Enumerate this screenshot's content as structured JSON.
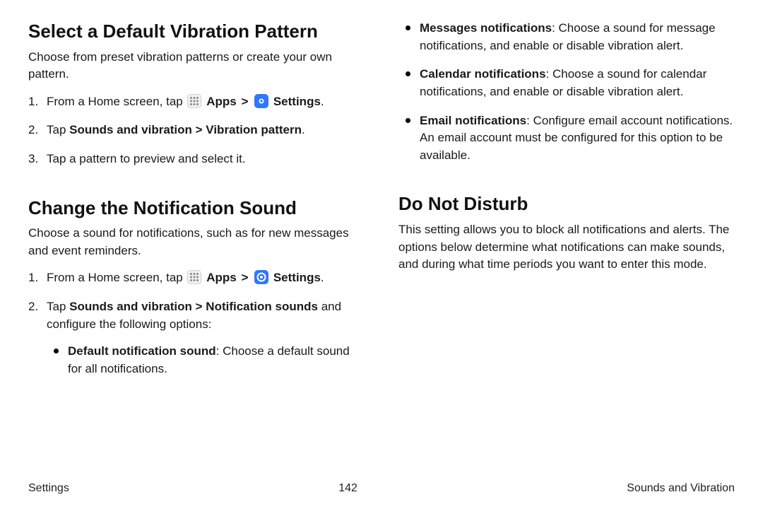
{
  "leftColumn": {
    "section1": {
      "heading": "Select a Default Vibration Pattern",
      "intro": "Choose from preset vibration patterns or create your own pattern.",
      "step1_pre": "From a Home screen, tap ",
      "apps_label": "Apps",
      "settings_label": "Settings",
      "step2_pre": "Tap ",
      "step2_bold": "Sounds and vibration > Vibration pattern",
      "step2_post": ".",
      "step3": "Tap a pattern to preview and select it."
    },
    "section2": {
      "heading": "Change the Notification Sound",
      "intro": "Choose a sound for notifications, such as for new messages and event reminders.",
      "step1_pre": "From a Home screen, tap ",
      "apps_label": "Apps",
      "settings_label": "Settings",
      "step2_pre": "Tap ",
      "step2_bold": "Sounds and vibration > Notification sounds",
      "step2_post": " and configure the following options:",
      "bullet1_bold": "Default notification sound",
      "bullet1_rest": ": Choose a default sound for all notifications."
    }
  },
  "rightColumn": {
    "bullets": {
      "b1_bold": "Messages notifications",
      "b1_rest": ": Choose a sound for message notifications, and enable or disable vibration alert.",
      "b2_bold": "Calendar notifications",
      "b2_rest": ": Choose a sound for calendar notifications, and enable or disable vibration alert.",
      "b3_bold": "Email notifications",
      "b3_rest": ": Configure email account notifications. An email account must be configured for this option to be available."
    },
    "section": {
      "heading": "Do Not Disturb",
      "intro": "This setting allows you to block all notifications and alerts. The options below determine what notifications can make sounds, and during what time periods you want to enter this mode."
    }
  },
  "footer": {
    "left": "Settings",
    "center": "142",
    "right": "Sounds and Vibration"
  },
  "glyphs": {
    "chevron": ">"
  }
}
